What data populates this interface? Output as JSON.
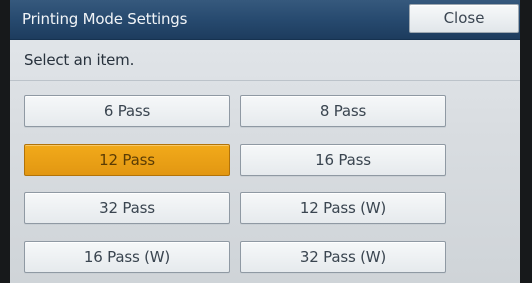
{
  "window": {
    "title": "Printing Mode Settings",
    "close_label": "Close"
  },
  "main": {
    "instruction": "Select an item.",
    "selected_option": "12 Pass",
    "options": [
      {
        "label": "6 Pass"
      },
      {
        "label": "8 Pass"
      },
      {
        "label": "12 Pass"
      },
      {
        "label": "16 Pass"
      },
      {
        "label": "32 Pass"
      },
      {
        "label": "12 Pass (W)"
      },
      {
        "label": "16 Pass (W)"
      },
      {
        "label": "32 Pass (W)"
      }
    ]
  },
  "colors": {
    "titlebar": "#274a6f",
    "selected": "#e9a016",
    "panel": "#dde1e5"
  }
}
